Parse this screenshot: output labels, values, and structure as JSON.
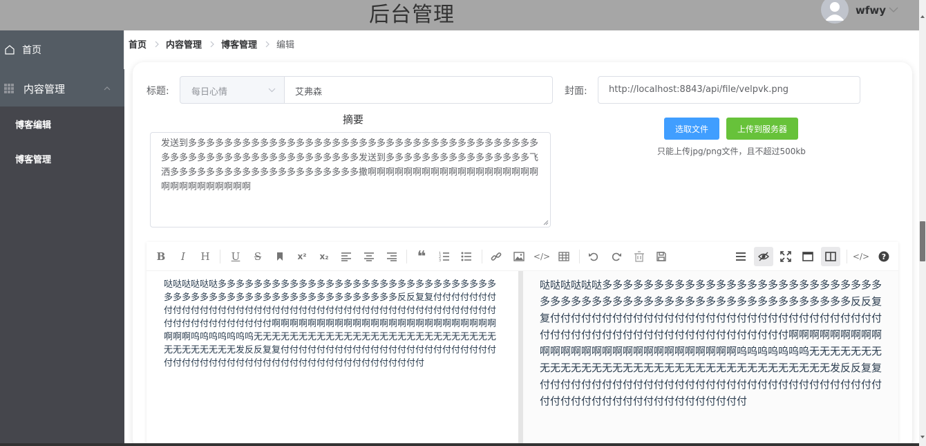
{
  "header": {
    "title": "后台管理",
    "username": "wfwy"
  },
  "sidebar": {
    "home": "首页",
    "content_mgmt": "内容管理",
    "sub_items": [
      "博客编辑",
      "博客管理"
    ]
  },
  "breadcrumb": [
    "首页",
    "内容管理",
    "博客管理",
    "编辑"
  ],
  "form": {
    "title_label": "标题:",
    "category_placeholder": "每日心情",
    "title_value": "艾弗森",
    "cover_label": "封面:",
    "cover_value": "http://localhost:8843/api/file/velpvk.png",
    "abstract_label": "摘要",
    "abstract_text": "发送到多多多多多多多多多多多多多多多多多多多多多多多多多多多多多多多多多多多多多多多多多多多多多多多多多多多多多多多多多多多多多发送到多多多多多多多多多多多多多多多多飞洒多多多多多多多多多多多多多多多多多多多多多撒啊啊啊啊啊啊啊啊啊啊啊啊啊啊啊啊啊啊啊啊啊啊啊啊啊啊啊啊啊",
    "pick_file_button": "选取文件",
    "upload_button": "上传到服务器",
    "upload_tip": "只能上传jpg/png文件，且不超过500kb"
  },
  "editor": {
    "content": "哒哒哒哒哒哒多多多多多多多多多多多多多多多多多多多多多多多多多多多多多多多多多多多多多多多多多多多多多多多多多多多多多多多多多反反复复付付付付付付付付付付付付付付付付付付付付付付付付付付付付付付付付付付付付付付付付付付付付付付付付付付付付付付付付啊啊啊啊啊啊啊啊啊啊啊啊啊啊啊啊啊啊啊啊啊啊啊啊啊啊啊啊呜呜呜呜呜呜呜无无无无无无无无无无无无无无无无无无无无无无无无无无无无无无无无无无无发反反复复付付付付付付付付付付付付付付付付付付付付付付付付付付付付付付付付付付付付付付付付付付付付付付付付付付付付付",
    "toolbar_icons": [
      "bold-icon",
      "italic-icon",
      "header-icon",
      "underline-icon",
      "strikethrough-icon",
      "mark-icon",
      "superscript-icon",
      "subscript-icon",
      "align-left-icon",
      "align-center-icon",
      "align-right-icon",
      "quote-icon",
      "ordered-list-icon",
      "unordered-list-icon",
      "link-icon",
      "image-icon",
      "code-icon",
      "table-icon",
      "undo-icon",
      "redo-icon",
      "trash-icon",
      "save-icon",
      "navigation-icon",
      "preview-icon",
      "fullscreen-icon",
      "read-mode-icon",
      "subfield-icon",
      "html-icon",
      "help-icon"
    ]
  },
  "colors": {
    "primary": "#409eff",
    "success": "#67c23a",
    "sidebar": "#545c64"
  }
}
